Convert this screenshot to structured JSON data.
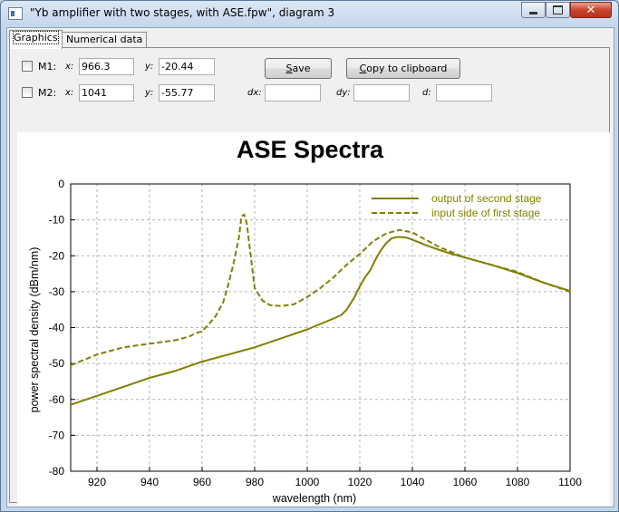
{
  "window": {
    "title": "\"Yb amplifier with two stages, with ASE.fpw\", diagram 3",
    "close_glyph": "✕"
  },
  "tabs": [
    {
      "label": "Graphics",
      "active": true
    },
    {
      "label": "Numerical data",
      "active": false
    }
  ],
  "markers": {
    "m1": {
      "label": "M1:",
      "x_label": "x:",
      "x": "966.3",
      "y_label": "y:",
      "y": "-20.44"
    },
    "m2": {
      "label": "M2:",
      "x_label": "x:",
      "x": "1041",
      "y_label": "y:",
      "y": "-55.77"
    },
    "dx_label": "dx:",
    "dy_label": "dy:",
    "d_label": "d:",
    "dx": "",
    "dy": "",
    "d": ""
  },
  "buttons": {
    "save_prefix": "",
    "save_underline": "S",
    "save_rest": "ave",
    "copy_prefix": "",
    "copy_underline": "C",
    "copy_rest": "opy to clipboard"
  },
  "chart_data": {
    "type": "line",
    "title": "ASE Spectra",
    "xlabel": "wavelength (nm)",
    "ylabel": "power spectral density (dBm/nm)",
    "xlim": [
      910,
      1100
    ],
    "ylim": [
      -80,
      0
    ],
    "x_ticks": [
      920,
      940,
      960,
      980,
      1000,
      1020,
      1040,
      1060,
      1080,
      1100
    ],
    "y_ticks": [
      0,
      -10,
      -20,
      -30,
      -40,
      -50,
      -60,
      -70,
      -80
    ],
    "grid": true,
    "legend_position": "top-right",
    "color": "#808000",
    "series": [
      {
        "name": "output of second stage",
        "style": "solid",
        "x": [
          910,
          920,
          930,
          940,
          950,
          960,
          970,
          980,
          990,
          1000,
          1005,
          1010,
          1013,
          1015,
          1018,
          1020,
          1022,
          1024,
          1026,
          1028,
          1030,
          1032,
          1034,
          1036,
          1038,
          1040,
          1045,
          1050,
          1055,
          1060,
          1070,
          1080,
          1090,
          1100
        ],
        "values": [
          -61.5,
          -59,
          -56.5,
          -54,
          -52,
          -49.5,
          -47.5,
          -45.5,
          -43,
          -40.5,
          -39,
          -37.5,
          -36.5,
          -35,
          -31.5,
          -28.5,
          -26,
          -24,
          -21,
          -18.5,
          -16.5,
          -15.2,
          -14.8,
          -14.8,
          -15,
          -15.5,
          -17,
          -18.3,
          -19.5,
          -20.5,
          -22.5,
          -24.8,
          -27.5,
          -29.8
        ]
      },
      {
        "name": "input side of first stage",
        "style": "dashed",
        "x": [
          910,
          920,
          930,
          940,
          950,
          955,
          958,
          960,
          962,
          965,
          968,
          970,
          972,
          974,
          975,
          976,
          977,
          978,
          980,
          983,
          986,
          990,
          995,
          1000,
          1005,
          1010,
          1015,
          1020,
          1025,
          1030,
          1035,
          1040,
          1045,
          1050,
          1060,
          1070,
          1080,
          1090,
          1100
        ],
        "values": [
          -50.5,
          -47.5,
          -45.5,
          -44.5,
          -43.5,
          -42.5,
          -41.5,
          -41,
          -39.5,
          -37,
          -33,
          -28,
          -22,
          -15,
          -9,
          -8.5,
          -11,
          -17,
          -29,
          -32.5,
          -33.8,
          -34,
          -33.5,
          -31.5,
          -29,
          -26,
          -22.5,
          -19.5,
          -16,
          -13.8,
          -12.8,
          -13.5,
          -15.5,
          -17.5,
          -20.5,
          -22.5,
          -24.5,
          -27.5,
          -30
        ]
      }
    ]
  }
}
